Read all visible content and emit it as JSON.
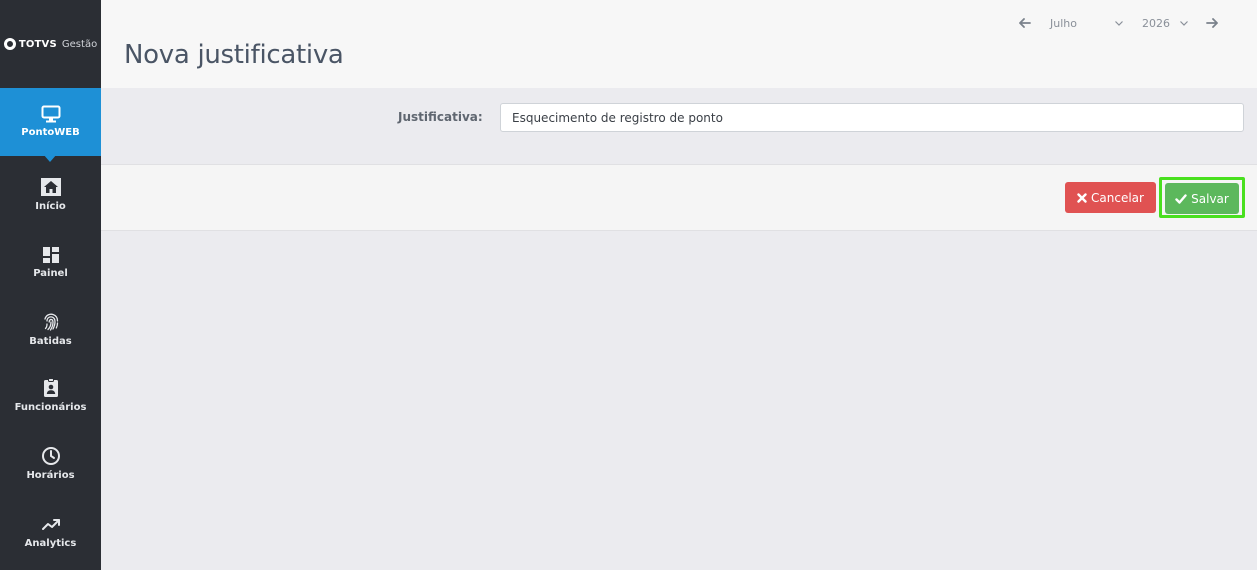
{
  "brand": {
    "name": "TOTVS",
    "product": "Gestão"
  },
  "sidebar": {
    "items": [
      {
        "label": "PontoWEB",
        "icon": "monitor-icon",
        "active": true
      },
      {
        "label": "Início",
        "icon": "home-icon"
      },
      {
        "label": "Painel",
        "icon": "dashboard-icon"
      },
      {
        "label": "Batidas",
        "icon": "fingerprint-icon"
      },
      {
        "label": "Funcionários",
        "icon": "id-badge-icon"
      },
      {
        "label": "Horários",
        "icon": "clock-icon"
      },
      {
        "label": "Analytics",
        "icon": "trend-line-icon"
      }
    ]
  },
  "header": {
    "title": "Nova justificativa",
    "period": {
      "month": "Julho",
      "year": "2026"
    }
  },
  "form": {
    "justificativa_label": "Justificativa:",
    "justificativa_value": "Esquecimento de registro de ponto"
  },
  "actions": {
    "cancel_label": "Cancelar",
    "save_label": "Salvar"
  },
  "colors": {
    "sidebar_bg": "#2b2e34",
    "active_blue": "#1e90d6",
    "cancel_red": "#e05252",
    "save_green": "#5cb85c",
    "highlight_green": "#49e01f"
  }
}
